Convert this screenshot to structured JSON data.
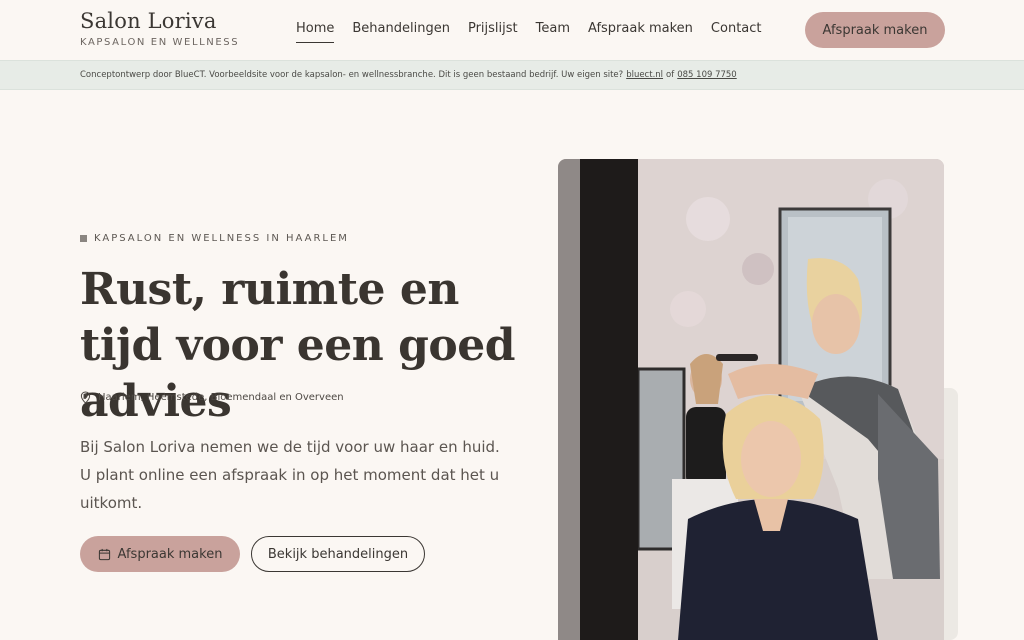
{
  "brand": {
    "name": "Salon Loriva",
    "tagline": "KAPSALON EN WELLNESS"
  },
  "nav": {
    "items": [
      "Home",
      "Behandelingen",
      "Prijslijst",
      "Team",
      "Afspraak maken",
      "Contact"
    ],
    "active": "Home",
    "cta_label": "Afspraak maken"
  },
  "notice": {
    "text": "Conceptontwerp door BlueCT. Voorbeeldsite voor de kapsalon- en wellnessbranche. Dit is geen bestaand bedrijf. Uw eigen site?",
    "link_site": "bluect.nl",
    "of": "of",
    "link_phone": "085 109 7750"
  },
  "hero": {
    "eyebrow": "KAPSALON EN WELLNESS IN HAARLEM",
    "title": "Rust, ruimte en tijd voor een goed advies",
    "location": "Haarlem, Heemstede, Bloemendaal en Overveen",
    "intro": "Bij Salon Loriva nemen we de tijd voor uw haar en huid. U plant online een afspraak in op het moment dat het u uitkomt.",
    "primary_button": "Afspraak maken",
    "secondary_button": "Bekijk behandelingen"
  },
  "colors": {
    "background": "#fbf7f3",
    "accent": "#c9a29c",
    "notice_bg": "#e7ece7",
    "text": "#3b3733"
  },
  "icons": {
    "location": "map-pin-icon",
    "calendar": "calendar-icon"
  }
}
